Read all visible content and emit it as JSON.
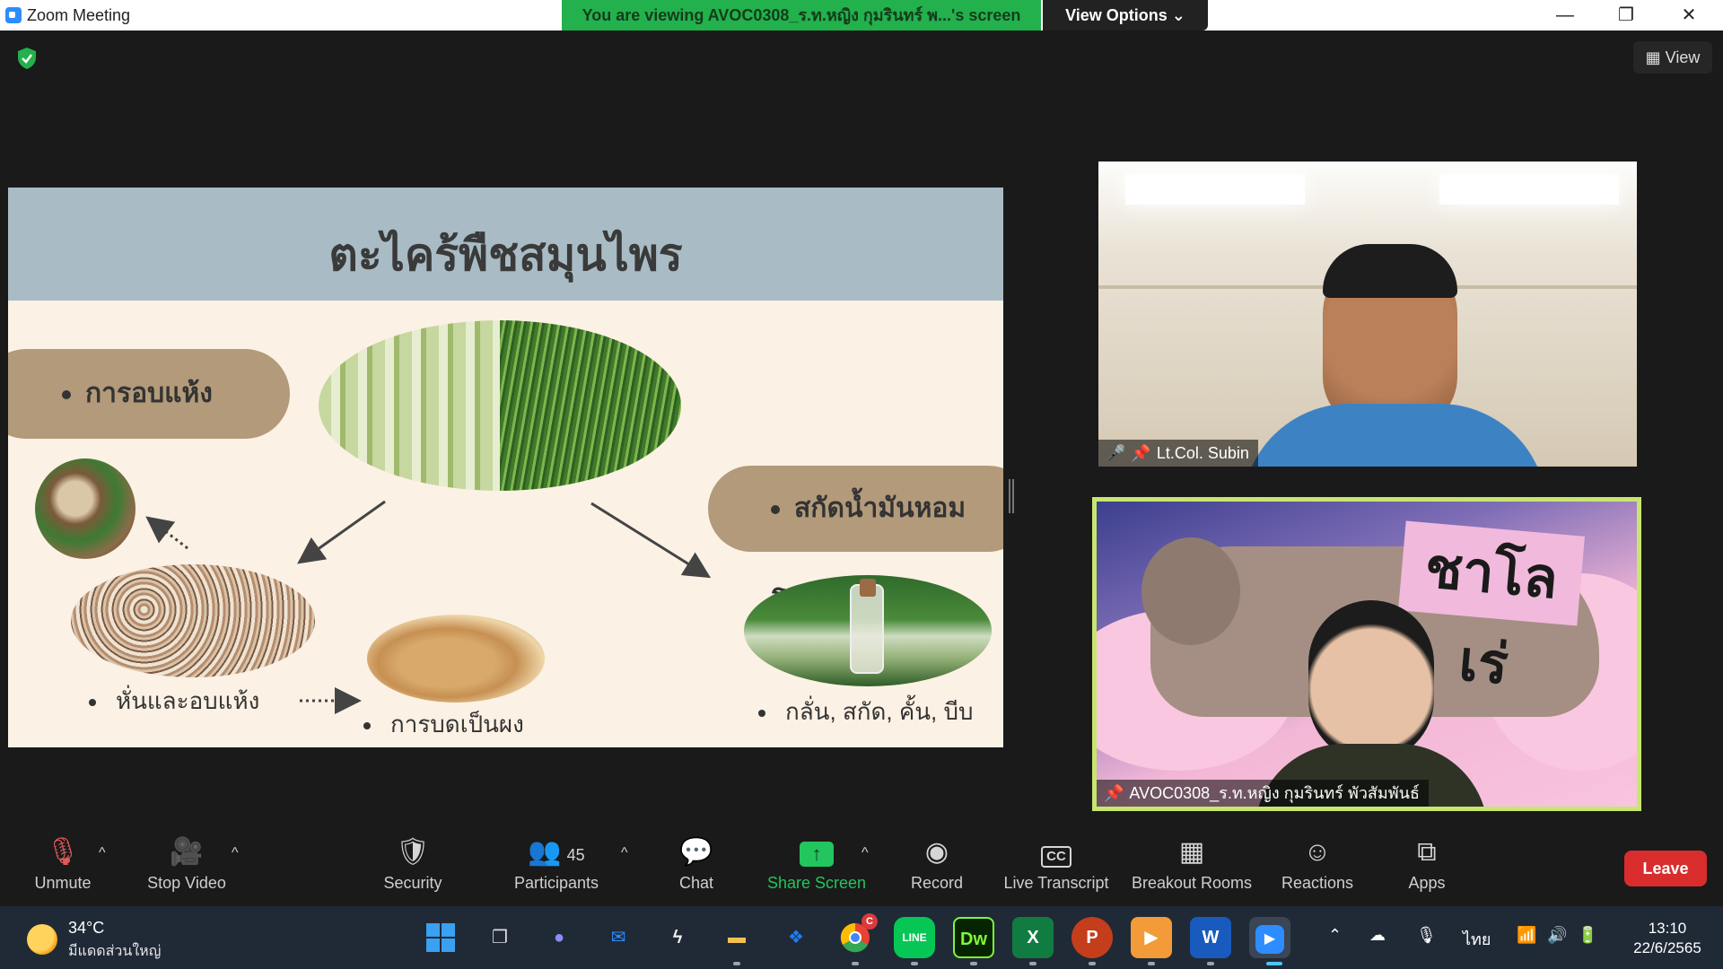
{
  "window": {
    "title": "Zoom Meeting",
    "banner": "You are viewing AVOC0308_ร.ท.หญิง กุมรินทร์ พ...'s screen",
    "view_options": "View Options ⌄",
    "controls": [
      "—",
      "❐",
      "✕"
    ]
  },
  "meeting": {
    "view_button": "View"
  },
  "slide": {
    "title": "ตะไคร้พืชสมุนไพร",
    "pill_dry": "การอบแห้ง",
    "pill_oil": "สกัดน้ำมันหอมระเหย",
    "caption_cut": "หั่นและอบแห้ง",
    "caption_grind": "การบดเป็นผง",
    "caption_extract": "กลั่น, สกัด, คั้น, บีบ"
  },
  "tiles": {
    "top_name": "Lt.Col. Subin",
    "bottom_name": "AVOC0308_ร.ท.หญิง กุมรินทร์ พัวสัมพันธ์",
    "sticker_text": "ชาโลเร่"
  },
  "toolbar": {
    "unmute": "Unmute",
    "stop_video": "Stop Video",
    "security": "Security",
    "participants": "Participants",
    "participants_count": "45",
    "chat": "Chat",
    "share_screen": "Share Screen",
    "record": "Record",
    "live_transcript": "Live Transcript",
    "breakout_rooms": "Breakout Rooms",
    "reactions": "Reactions",
    "apps": "Apps",
    "leave": "Leave",
    "share_color": "#22c55e",
    "leave_color": "#d92d2d"
  },
  "taskbar": {
    "weather_temp": "34°C",
    "weather_desc": "มีแดดส่วนใหญ่",
    "apps": [
      "start-icon",
      "task-view-icon",
      "teams-chat-icon",
      "mail-icon",
      "stylus-app-icon",
      "file-explorer-icon",
      "dropbox-icon",
      "chrome-icon",
      "line-icon",
      "dreamweaver-icon",
      "excel-icon",
      "powerpoint-icon",
      "media-player-icon",
      "word-icon",
      "zoom-icon"
    ],
    "dw_label": "Dw",
    "excel_label": "X",
    "ppt_label": "P",
    "word_label": "W",
    "line_label": "LINE",
    "lang": "ไทย",
    "time": "13:10",
    "date": "22/6/2565",
    "chrome_badge": "C"
  }
}
